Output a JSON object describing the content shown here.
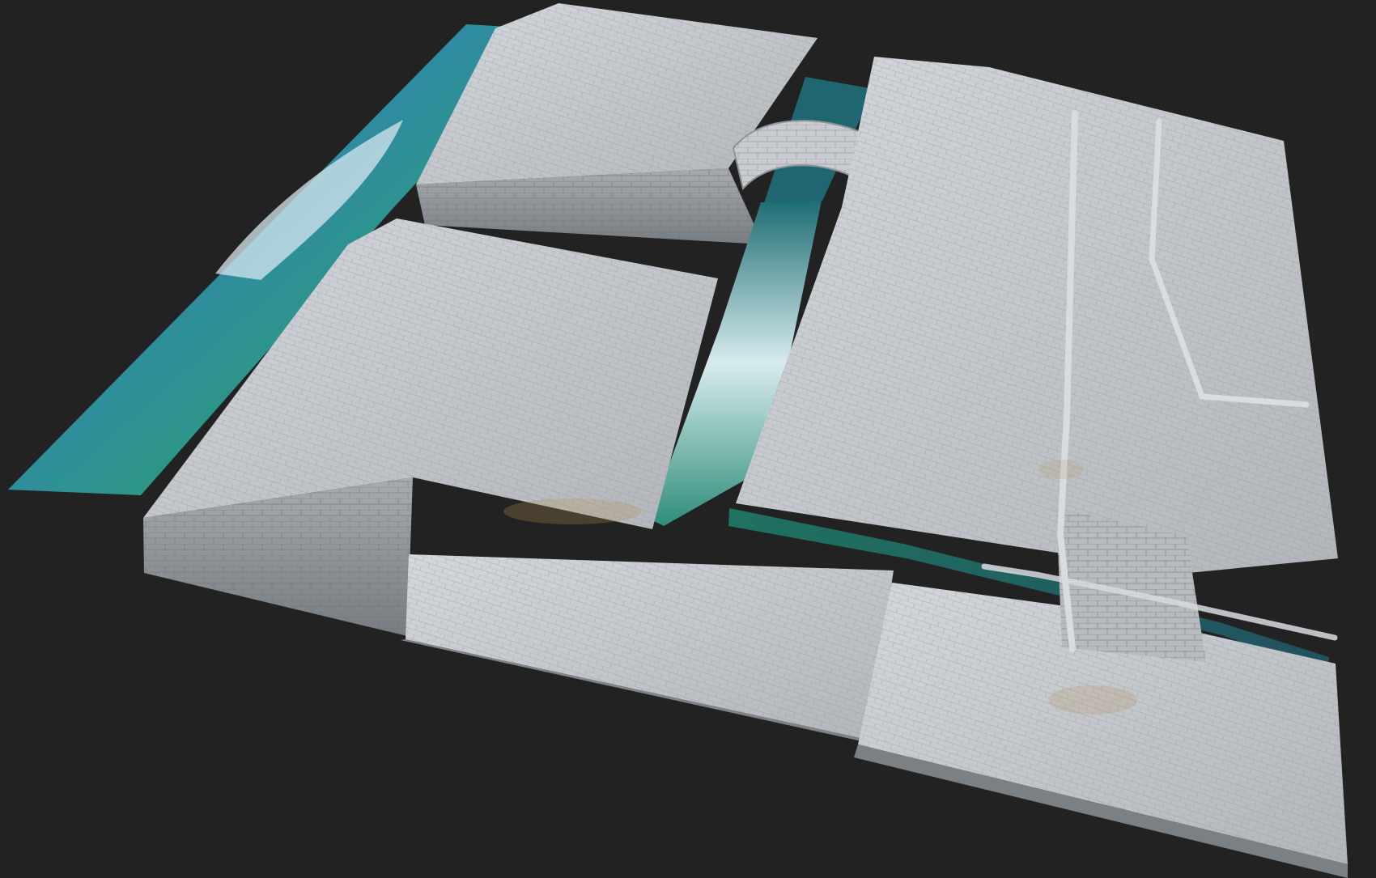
{
  "photo": {
    "subject": "",
    "colors": {
      "background": "#222222",
      "stone_light": "#c9ccd0",
      "stone_mid": "#a8acb1",
      "stone_shadow": "#7f8489",
      "water_deep": "#1f3f9f",
      "water_teal": "#2f8b7a",
      "water_highlight": "#d9ecef"
    }
  }
}
